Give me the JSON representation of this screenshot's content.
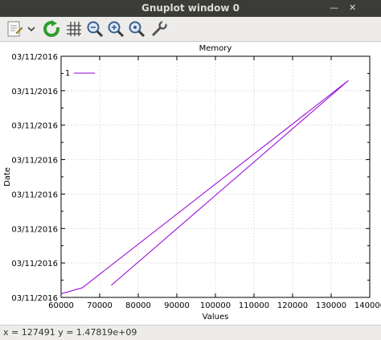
{
  "window": {
    "title": "Gnuplot window 0",
    "minimize_glyph": "—",
    "close_glyph": "✕"
  },
  "toolbar": {
    "icons": [
      "copy-to-clipboard-icon",
      "dropdown-chevron-icon",
      "replot-icon",
      "grid-icon",
      "zoom-previous-icon",
      "zoom-next-icon",
      "autoscale-icon",
      "settings-wrench-icon"
    ]
  },
  "status": {
    "text": "x = 127491 y = 1.47819e+09"
  },
  "chart_data": {
    "type": "line",
    "title": "Memory",
    "xlabel": "Values",
    "ylabel": "Date",
    "xlim": [
      60000,
      140000
    ],
    "x_ticks": [
      60000,
      70000,
      80000,
      90000,
      100000,
      110000,
      120000,
      130000,
      140000
    ],
    "y_tick_labels": [
      "03/11/2016",
      "03/11/2016",
      "03/11/2016",
      "03/11/2016",
      "03/11/2016",
      "03/11/2016",
      "03/11/2016",
      "03/11/2016"
    ],
    "grid": true,
    "legend_position": "top-left",
    "series": [
      {
        "name": "1",
        "color": "#9400d3",
        "x": [
          60000,
          65500,
          134500,
          73000
        ],
        "y_fraction": [
          0.015,
          0.04,
          0.9,
          0.05
        ]
      }
    ]
  }
}
